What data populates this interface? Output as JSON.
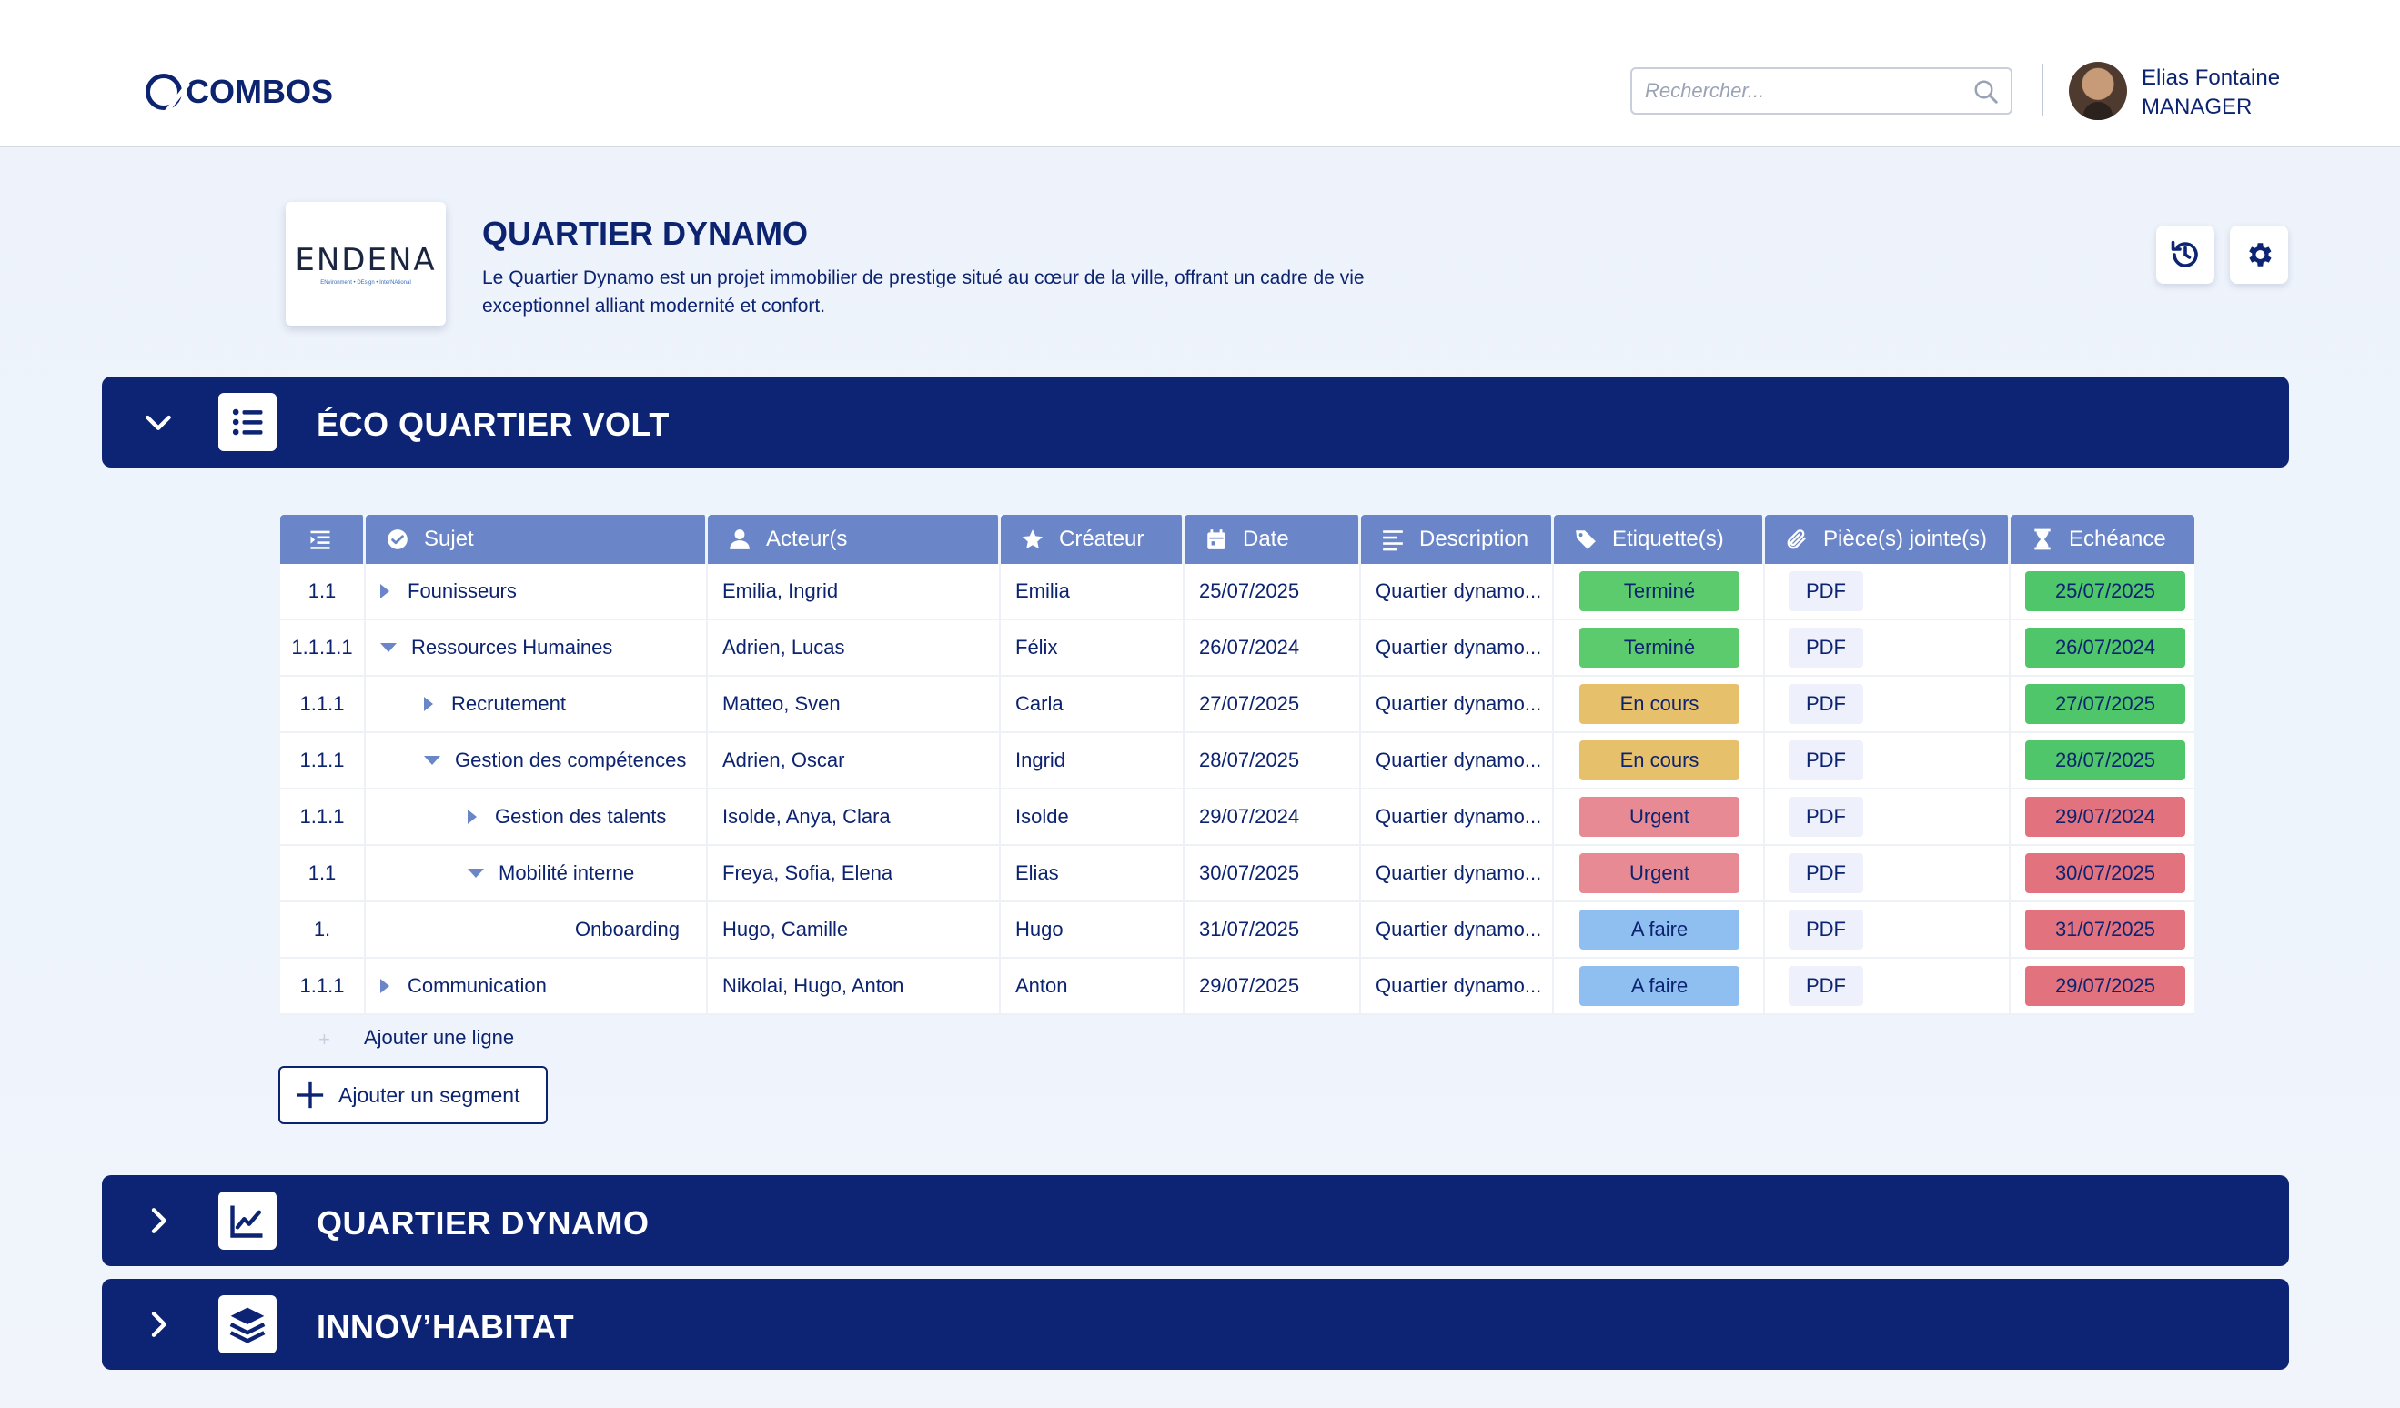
{
  "app": {
    "logo_text": "COMBOS",
    "search_placeholder": "Rechercher...",
    "user": {
      "name": "Elias Fontaine",
      "role": "MANAGER"
    }
  },
  "project": {
    "logo_text": "ENDENA",
    "logo_subtext": "ENvironment • DEsign • InterNAtional",
    "title": "QUARTIER DYNAMO",
    "description": "Le Quartier Dynamo est un projet immobilier de prestige situé au cœur de la ville, offrant un cadre de vie exceptionnel alliant modernité et confort."
  },
  "sections": [
    {
      "title": "ÉCO QUARTIER VOLT",
      "expanded": true,
      "icon": "list-icon"
    },
    {
      "title": "QUARTIER DYNAMO",
      "expanded": false,
      "icon": "chart-line-icon"
    },
    {
      "title": "INNOV’HABITAT",
      "expanded": false,
      "icon": "layers-icon"
    }
  ],
  "table": {
    "columns": [
      "",
      "Sujet",
      "Acteur(s",
      "Créateur",
      "Date",
      "Description",
      "Etiquette(s)",
      "Pièce(s) jointe(s)",
      "Echéance"
    ],
    "rows": [
      {
        "num": "1.1",
        "subject": "Founisseurs",
        "level": 0,
        "toggle": "collapsed",
        "actors": "Emilia, Ingrid",
        "creator": "Emilia",
        "date": "25/07/2025",
        "description": "Quartier dynamo...",
        "tag": "Terminé",
        "tag_status": "done",
        "attachment": "PDF",
        "due": "25/07/2025",
        "due_status": "ok"
      },
      {
        "num": "1.1.1.1",
        "subject": "Ressources Humaines",
        "level": 0,
        "toggle": "expanded",
        "actors": "Adrien, Lucas",
        "creator": "Félix",
        "date": "26/07/2024",
        "description": "Quartier dynamo...",
        "tag": "Terminé",
        "tag_status": "done",
        "attachment": "PDF",
        "due": "26/07/2024",
        "due_status": "ok"
      },
      {
        "num": "1.1.1",
        "subject": "Recrutement",
        "level": 1,
        "toggle": "collapsed",
        "actors": "Matteo, Sven",
        "creator": "Carla",
        "date": "27/07/2025",
        "description": "Quartier dynamo...",
        "tag": "En cours",
        "tag_status": "progress",
        "attachment": "PDF",
        "due": "27/07/2025",
        "due_status": "ok"
      },
      {
        "num": "1.1.1",
        "subject": "Gestion des compétences",
        "level": 1,
        "toggle": "expanded",
        "actors": "Adrien, Oscar",
        "creator": "Ingrid",
        "date": "28/07/2025",
        "description": "Quartier dynamo...",
        "tag": "En cours",
        "tag_status": "progress",
        "attachment": "PDF",
        "due": "28/07/2025",
        "due_status": "ok"
      },
      {
        "num": "1.1.1",
        "subject": "Gestion des talents",
        "level": 2,
        "toggle": "collapsed",
        "actors": "Isolde, Anya, Clara",
        "creator": "Isolde",
        "date": "29/07/2024",
        "description": "Quartier dynamo...",
        "tag": "Urgent",
        "tag_status": "urgent",
        "attachment": "PDF",
        "due": "29/07/2024",
        "due_status": "late"
      },
      {
        "num": "1.1",
        "subject": "Mobilité interne",
        "level": 2,
        "toggle": "expanded",
        "actors": "Freya, Sofia, Elena",
        "creator": "Elias",
        "date": "30/07/2025",
        "description": "Quartier dynamo...",
        "tag": "Urgent",
        "tag_status": "urgent",
        "attachment": "PDF",
        "due": "30/07/2025",
        "due_status": "late"
      },
      {
        "num": "1.",
        "subject": "Onboarding",
        "level": 3,
        "toggle": "none",
        "actors": "Hugo, Camille",
        "creator": "Hugo",
        "date": "31/07/2025",
        "description": "Quartier dynamo...",
        "tag": "A faire",
        "tag_status": "todo",
        "attachment": "PDF",
        "due": "31/07/2025",
        "due_status": "late"
      },
      {
        "num": "1.1.1",
        "subject": "Communication",
        "level": 0,
        "toggle": "collapsed",
        "actors": "Nikolai, Hugo, Anton",
        "creator": "Anton",
        "date": "29/07/2025",
        "description": "Quartier dynamo...",
        "tag": "A faire",
        "tag_status": "todo",
        "attachment": "PDF",
        "due": "29/07/2025",
        "due_status": "late"
      }
    ],
    "add_line_label": "Ajouter une ligne",
    "add_segment_label": "Ajouter un segment"
  },
  "colors": {
    "primary": "#0c2473",
    "header": "#6b86c8",
    "tag_done": "#5ccb6e",
    "tag_progress": "#e7c06c",
    "tag_urgent": "#e78a93",
    "tag_todo": "#8fbff0",
    "due_ok": "#4fc66a",
    "due_late": "#e2727d"
  }
}
